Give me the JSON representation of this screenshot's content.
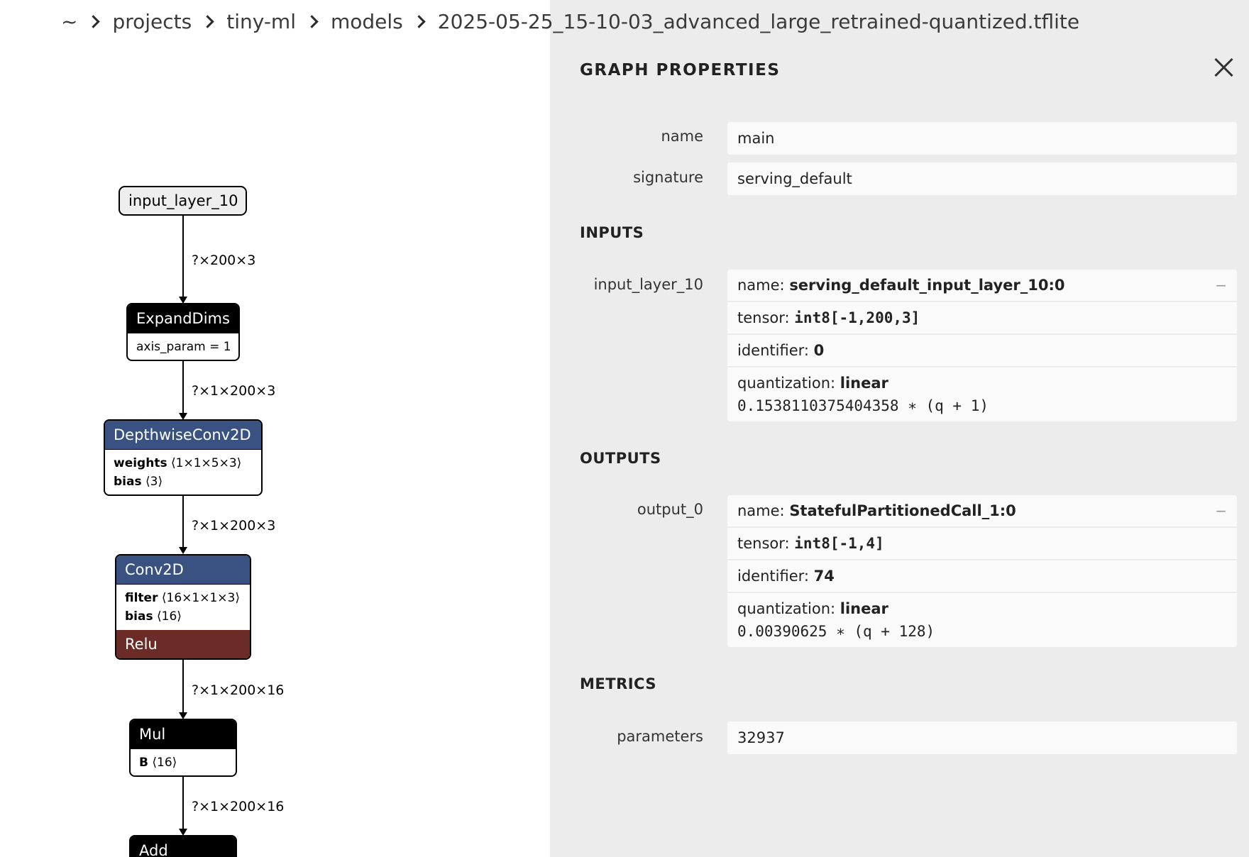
{
  "breadcrumb": {
    "home": "~",
    "items": [
      "projects",
      "tiny-ml",
      "models",
      "2025-05-25_15-10-03_advanced_large_retrained-quantized.tflite"
    ]
  },
  "graph": {
    "nodes": {
      "input": {
        "label": "input_layer_10"
      },
      "expanddims": {
        "label": "ExpandDims",
        "attr": "axis_param = 1"
      },
      "depthwise": {
        "label": "DepthwiseConv2D",
        "w_key": "weights",
        "w_val": "⟨1×1×5×3⟩",
        "b_key": "bias",
        "b_val": "⟨3⟩"
      },
      "conv2d": {
        "label": "Conv2D",
        "f_key": "filter",
        "f_val": "⟨16×1×1×3⟩",
        "b_key": "bias",
        "b_val": "⟨16⟩",
        "activation": "Relu"
      },
      "mul": {
        "label": "Mul",
        "b_key": "B",
        "b_val": "⟨16⟩"
      },
      "add": {
        "label": "Add"
      }
    },
    "edges": [
      "?×200×3",
      "?×1×200×3",
      "?×1×200×3",
      "?×1×200×16",
      "?×1×200×16"
    ]
  },
  "panel": {
    "title": "GRAPH PROPERTIES",
    "props": [
      {
        "label": "name",
        "value": "main"
      },
      {
        "label": "signature",
        "value": "serving_default"
      }
    ],
    "inputs_title": "INPUTS",
    "input": {
      "label": "input_layer_10",
      "name_key": "name: ",
      "name_val": "serving_default_input_layer_10:0",
      "tensor_key": "tensor: ",
      "tensor_val": "int8[-1,200,3]",
      "id_key": "identifier: ",
      "id_val": "0",
      "quant_key": "quantization: ",
      "quant_val": "linear",
      "quant_formula": "0.1538110375404358 ∗ (q + 1)"
    },
    "outputs_title": "OUTPUTS",
    "output": {
      "label": "output_0",
      "name_key": "name: ",
      "name_val": "StatefulPartitionedCall_1:0",
      "tensor_key": "tensor: ",
      "tensor_val": "int8[-1,4]",
      "id_key": "identifier: ",
      "id_val": "74",
      "quant_key": "quantization: ",
      "quant_val": "linear",
      "quant_formula": "0.00390625 ∗ (q + 128)"
    },
    "metrics_title": "METRICS",
    "metrics": [
      {
        "label": "parameters",
        "value": "32937"
      }
    ],
    "collapse_symbol": "−"
  }
}
